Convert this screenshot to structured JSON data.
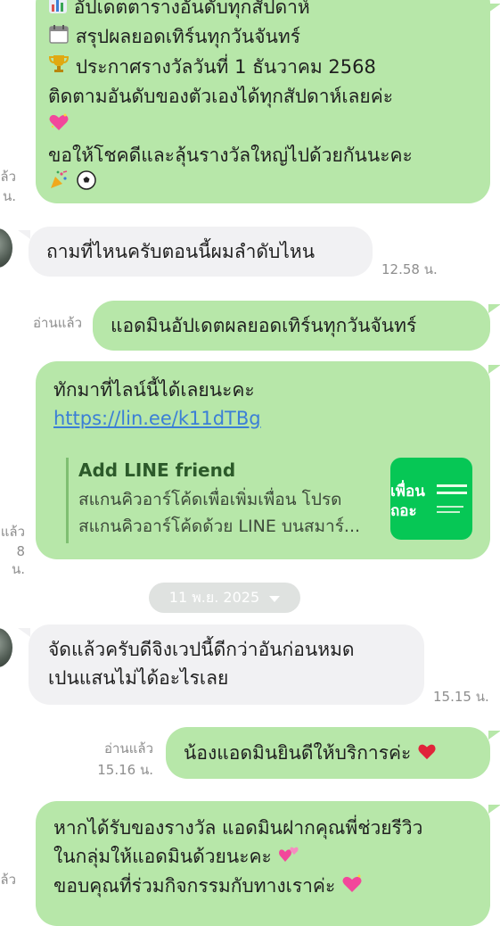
{
  "colors": {
    "outgoing_bubble": "#b7e7a9",
    "incoming_bubble": "#f1f1f3",
    "link": "#3b7fd6",
    "line_green": "#06c755",
    "meta_text": "#8e8e8e"
  },
  "messages": {
    "m1": {
      "lines": [
        "อัปเดตตารางอันดับทุกสัปดาห์",
        "สรุปผลยอดเทิร์นทุกวันจันทร์",
        "ประกาศรางวัลวันที่ 1 ธันวาคม 2568",
        "ติดตามอันดับของตัวเองได้ทุกสัปดาห์เลยค่ะ",
        "ขอให้โชคดีและลุ้นรางวัลใหญ่ไปด้วยกันนะคะ"
      ],
      "icons": [
        "bar-chart-icon",
        "calendar-icon",
        "trophy-icon",
        "sparkling-heart-icon",
        "party-popper-icon",
        "soccer-ball-icon"
      ],
      "read_fragment": "ล้ว",
      "time_fragment": "น."
    },
    "m2": {
      "text": "ถามที่ไหนครับตอนนี้ผมลำดับไหน",
      "time": "12.58 น."
    },
    "m3": {
      "text": "แอดมินอัปเดตผลยอดเทิร์นทุกวันจันทร์",
      "read": "อ่านแล้ว"
    },
    "m4": {
      "text": "ทักมาที่ไลน์นี้ได้เลยนะคะ",
      "link": "https://lin.ee/k11dTBg",
      "card_title": "Add LINE friend",
      "card_desc_1": "สแกนคิวอาร์โค้ดเพื่อเพิ่มเพื่อน โปรด",
      "card_desc_2": "สแกนคิวอาร์โค้ดด้วย LINE บนสมาร์...",
      "thumb_text_1": "เพื่อน",
      "thumb_text_2": "ถอะ",
      "read_fragment": "แล้ว",
      "time_fragment": "8 น."
    },
    "date_divider": "11 พ.ย. 2025",
    "m5": {
      "line1": "จัดแล้วครับดีจิงเวปนี้ดีกว่าอันก่อนหมด",
      "line2": "เปนแสนไม่ได้อะไรเลย",
      "time": "15.15 น."
    },
    "m6": {
      "text": "น้องแอดมินยินดีให้บริการค่ะ",
      "read": "อ่านแล้ว",
      "time": "15.16 น."
    },
    "m7": {
      "line1": "หากได้รับของรางวัล แอดมินฝากคุณพี่ช่วยรีวิว",
      "line2": "ในกลุ่มให้แอดมินด้วยนะคะ",
      "line3": "ขอบคุณที่ร่วมกิจกรรมกับทางเราค่ะ",
      "read_fragment": "ล้ว"
    }
  }
}
